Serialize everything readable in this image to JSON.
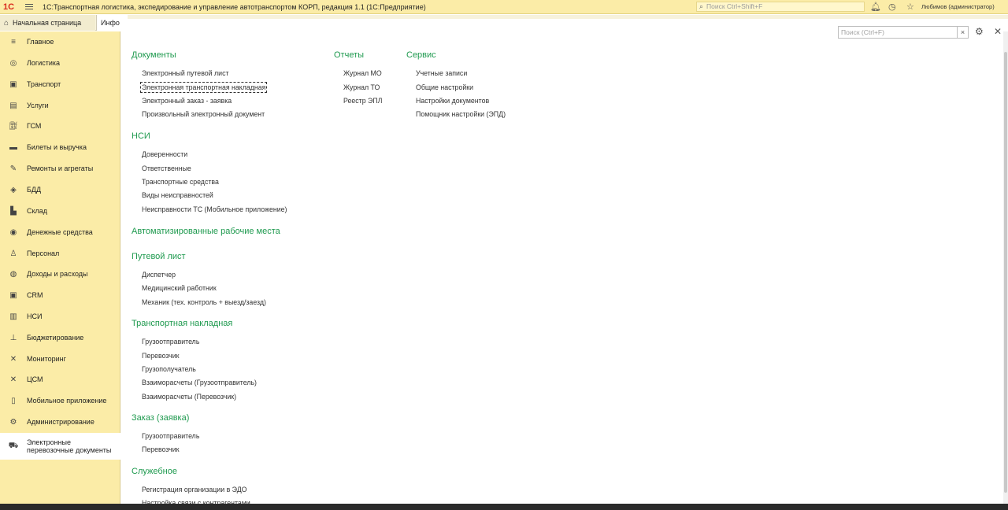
{
  "app": {
    "logo": "1С",
    "title": "1С:Транспортная логистика, экспедирование и управление автотранспортом КОРП, редакция 1.1  (1С:Предприятие)",
    "search_placeholder": "Поиск Ctrl+Shift+F",
    "user": "Любимов (администратор)"
  },
  "tabs": {
    "home": "Начальная страница",
    "info": "Инфо"
  },
  "sidebar": {
    "items": [
      {
        "label": "Главное",
        "icon": "menu-icon"
      },
      {
        "label": "Логистика",
        "icon": "compass-icon"
      },
      {
        "label": "Транспорт",
        "icon": "truck-icon"
      },
      {
        "label": "Услуги",
        "icon": "calculator-icon"
      },
      {
        "label": "ГСМ",
        "icon": "fuel-icon"
      },
      {
        "label": "Билеты и выручка",
        "icon": "ticket-icon"
      },
      {
        "label": "Ремонты и агрегаты",
        "icon": "wrench-icon"
      },
      {
        "label": "БДД",
        "icon": "safety-icon"
      },
      {
        "label": "Склад",
        "icon": "warehouse-icon"
      },
      {
        "label": "Денежные средства",
        "icon": "money-icon"
      },
      {
        "label": "Персонал",
        "icon": "person-icon"
      },
      {
        "label": "Доходы и расходы",
        "icon": "income-icon"
      },
      {
        "label": "CRM",
        "icon": "crm-icon"
      },
      {
        "label": "НСИ",
        "icon": "books-icon"
      },
      {
        "label": "Бюджетирование",
        "icon": "budget-icon"
      },
      {
        "label": "Мониторинг",
        "icon": "satellite-icon"
      },
      {
        "label": "ЦСМ",
        "icon": "satellite-icon"
      },
      {
        "label": "Мобильное приложение",
        "icon": "phone-icon"
      },
      {
        "label": "Администрирование",
        "icon": "gear-icon"
      },
      {
        "label": "Электронные\nперевозочные документы",
        "icon": "edoc-icon"
      }
    ]
  },
  "panel": {
    "search_placeholder": "Поиск (Ctrl+F)",
    "clear": "×"
  },
  "sections": {
    "docs": {
      "title": "Документы",
      "items": [
        "Электронный путевой лист",
        "Электронная транспортная накладная",
        "Электронный заказ - заявка",
        "Произвольный электронный документ"
      ]
    },
    "nsi": {
      "title": "НСИ",
      "items": [
        "Доверенности",
        "Ответственные",
        "Транспортные средства",
        "Виды неисправностей",
        "Неисправности ТС (Мобильное приложение)"
      ]
    },
    "arm": {
      "title": "Автоматизированные рабочие места",
      "items": []
    },
    "waybill": {
      "title": "Путевой лист",
      "items": [
        "Диспетчер",
        "Медицинский работник",
        "Механик (тех. контроль + выезд/заезд)"
      ]
    },
    "tn": {
      "title": "Транспортная накладная",
      "items": [
        "Грузоотправитель",
        "Перевозчик",
        "Грузополучатель",
        "Взаиморасчеты (Грузоотправитель)",
        "Взаиморасчеты (Перевозчик)"
      ]
    },
    "order": {
      "title": "Заказ (заявка)",
      "items": [
        "Грузоотправитель",
        "Перевозчик"
      ]
    },
    "service_sec": {
      "title": "Служебное",
      "items": [
        "Регистрация организации в ЭДО",
        "Настройка связи с контрагентами"
      ]
    },
    "reports": {
      "title": "Отчеты",
      "items": [
        "Журнал МО",
        "Журнал ТО",
        "Реестр ЭПЛ"
      ]
    },
    "service": {
      "title": "Сервис",
      "items": [
        "Учетные записи",
        "Общие настройки",
        "Настройки документов",
        "Помощник настройки (ЭПД)"
      ]
    }
  },
  "colors": {
    "accent": "#1f9a4f",
    "sidebar": "#fbeca7",
    "logo": "#d92b1f"
  }
}
